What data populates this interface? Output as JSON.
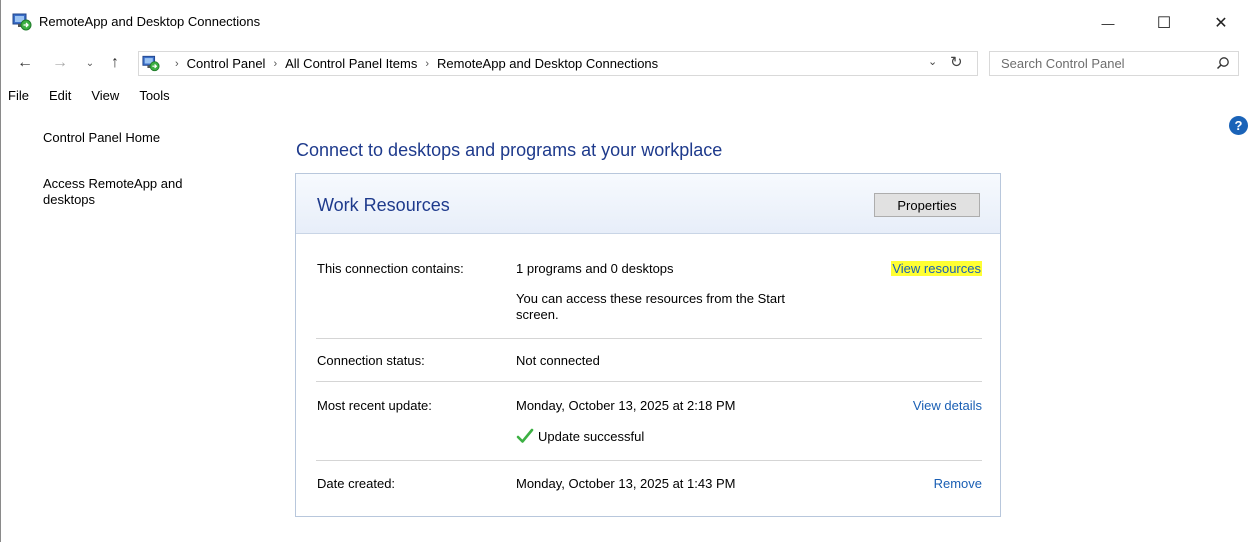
{
  "window": {
    "title": "RemoteApp and Desktop Connections",
    "minimize_glyph": "—",
    "maximize_glyph": "☐",
    "close_glyph": "✕"
  },
  "nav": {
    "back_glyph": "←",
    "forward_glyph": "→",
    "recent_glyph": "⌄",
    "up_glyph": "↑",
    "breadcrumbs": [
      "Control Panel",
      "All Control Panel Items",
      "RemoteApp and Desktop Connections"
    ],
    "separator": "›",
    "dropdown_glyph": "⌄",
    "refresh_glyph": "↻",
    "search_placeholder": "Search Control Panel"
  },
  "menu": [
    "File",
    "Edit",
    "View",
    "Tools"
  ],
  "sidebar": {
    "items": [
      {
        "label": "Control Panel Home"
      },
      {
        "label": "Access RemoteApp and desktops"
      }
    ]
  },
  "help_glyph": "?",
  "main": {
    "title": "Connect to desktops and programs at your workplace",
    "panel": {
      "title": "Work Resources",
      "properties_label": "Properties",
      "rows": [
        {
          "label": "This connection contains:",
          "value": "1 programs and 0 desktops",
          "detail": "You can access these resources from the Start screen.",
          "link": "View resources"
        },
        {
          "label": "Connection status:",
          "value": "Not connected"
        },
        {
          "label": "Most recent update:",
          "value": "Monday, October 13, 2025 at 2:18 PM",
          "status": "Update successful",
          "link": "View details"
        },
        {
          "label": "Date created:",
          "value": "Monday, October 13, 2025 at 1:43 PM",
          "link": "Remove"
        }
      ]
    }
  },
  "colors": {
    "heading": "#1e3a8c",
    "link": "#1a5fb4",
    "highlight": "#ffff33",
    "success": "#3cb043"
  },
  "icons": {
    "app": "remoteapp-icon",
    "search": "search-icon",
    "help": "help-icon",
    "check": "checkmark-icon"
  }
}
